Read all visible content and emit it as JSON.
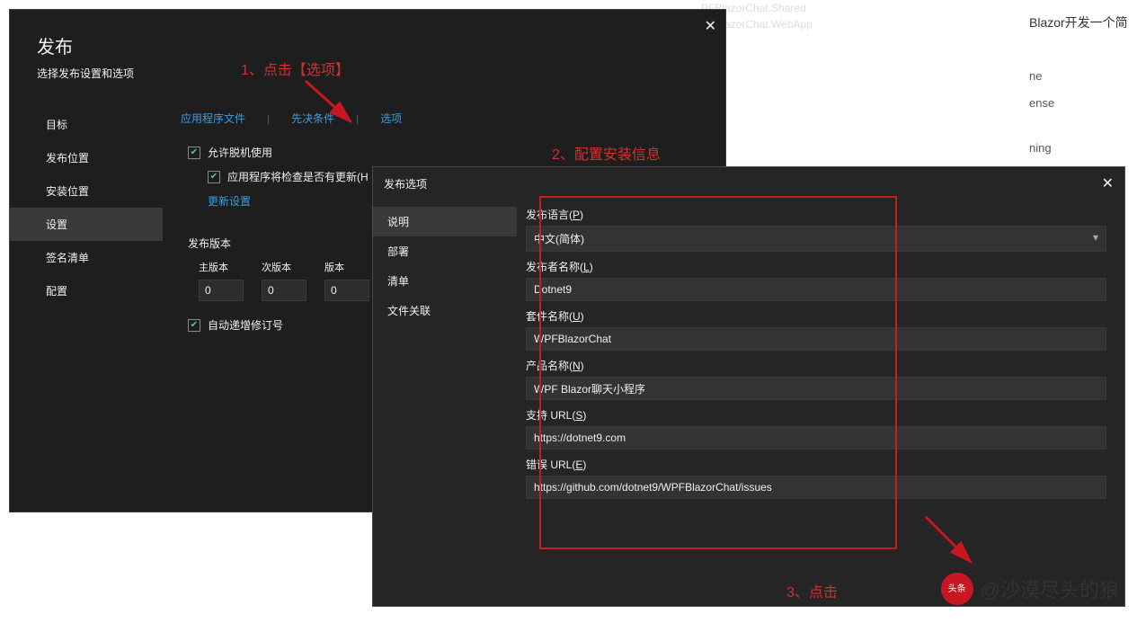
{
  "bg": {
    "file1": "PFBlazorChat.Shared",
    "file2": "PFBlazorChat.WebApp",
    "title_frag": "Blazor开发一个简",
    "items": [
      "ne",
      "ense",
      "ning"
    ]
  },
  "d1": {
    "title": "发布",
    "subtitle": "选择发布设置和选项",
    "sidebar": {
      "target": "目标",
      "publoc": "发布位置",
      "instloc": "安装位置",
      "settings": "设置",
      "signing": "签名清单",
      "config": "配置"
    },
    "tabs": {
      "files": "应用程序文件",
      "prereq": "先决条件",
      "options": "选项"
    },
    "chk_offline": "允许脱机使用",
    "chk_updates": "应用程序将检查是否有更新(H",
    "update_settings": "更新设置",
    "pub_version": "发布版本",
    "ver": {
      "major": "主版本",
      "minor": "次版本",
      "build": "版本"
    },
    "ver_vals": {
      "major": "0",
      "minor": "0",
      "build": "0"
    },
    "chk_autoinc": "自动递增修订号"
  },
  "d2": {
    "title": "发布选项",
    "sidebar": {
      "desc": "说明",
      "deploy": "部署",
      "manifest": "清单",
      "fileassoc": "文件关联"
    },
    "fields": {
      "lang_label": "发布语言(P)",
      "lang_value": "中文(简体)",
      "publisher_label": "发布者名称(L)",
      "publisher_value": "Dotnet9",
      "suite_label": "套件名称(U)",
      "suite_value": "WPFBlazorChat",
      "product_label": "产品名称(N)",
      "product_value": "WPF Blazor聊天小程序",
      "support_label": "支持 URL(S)",
      "support_value": "https://dotnet9.com",
      "error_label": "错误 URL(E)",
      "error_value": "https://github.com/dotnet9/WPFBlazorChat/issues"
    }
  },
  "ann": {
    "step1": "1、点击【选项】",
    "step2": "2、配置安装信息",
    "step3": "3、点击"
  },
  "wm": {
    "logo_top": "头条",
    "text": "@沙漠尽头的狼"
  }
}
